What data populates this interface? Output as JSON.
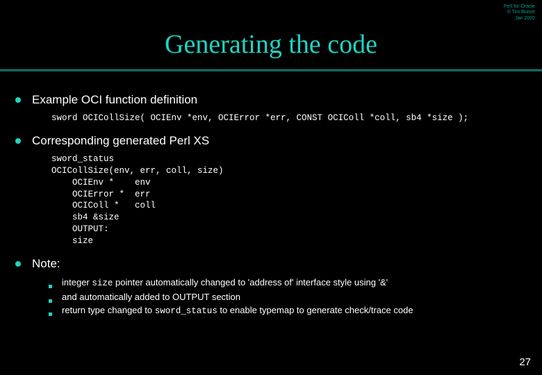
{
  "header": {
    "line1": "Perl for Oracle",
    "line2": "© Tim Bunce",
    "line3": "Jan 2002"
  },
  "title": "Generating the code",
  "section1": {
    "label": "Example OCI function definition",
    "code": "sword OCICollSize( OCIEnv *env, OCIError *err, CONST OCIColl *coll, sb4 *size );"
  },
  "section2": {
    "label": "Corresponding generated Perl XS",
    "code": "sword_status\nOCICollSize(env, err, coll, size)\n    OCIEnv *    env\n    OCIError *  err\n    OCIColl *   coll\n    sb4 &size\n    OUTPUT:\n    size"
  },
  "section3": {
    "label": "Note:",
    "items": {
      "a_pre": "integer ",
      "a_mono": "size",
      "a_post": " pointer automatically changed to 'address of' interface style using '&'",
      "b": "and automatically added to OUTPUT section",
      "c_pre": "return type changed to ",
      "c_mono": "sword_status",
      "c_post": " to enable typemap to generate check/trace code"
    }
  },
  "page_number": "27"
}
